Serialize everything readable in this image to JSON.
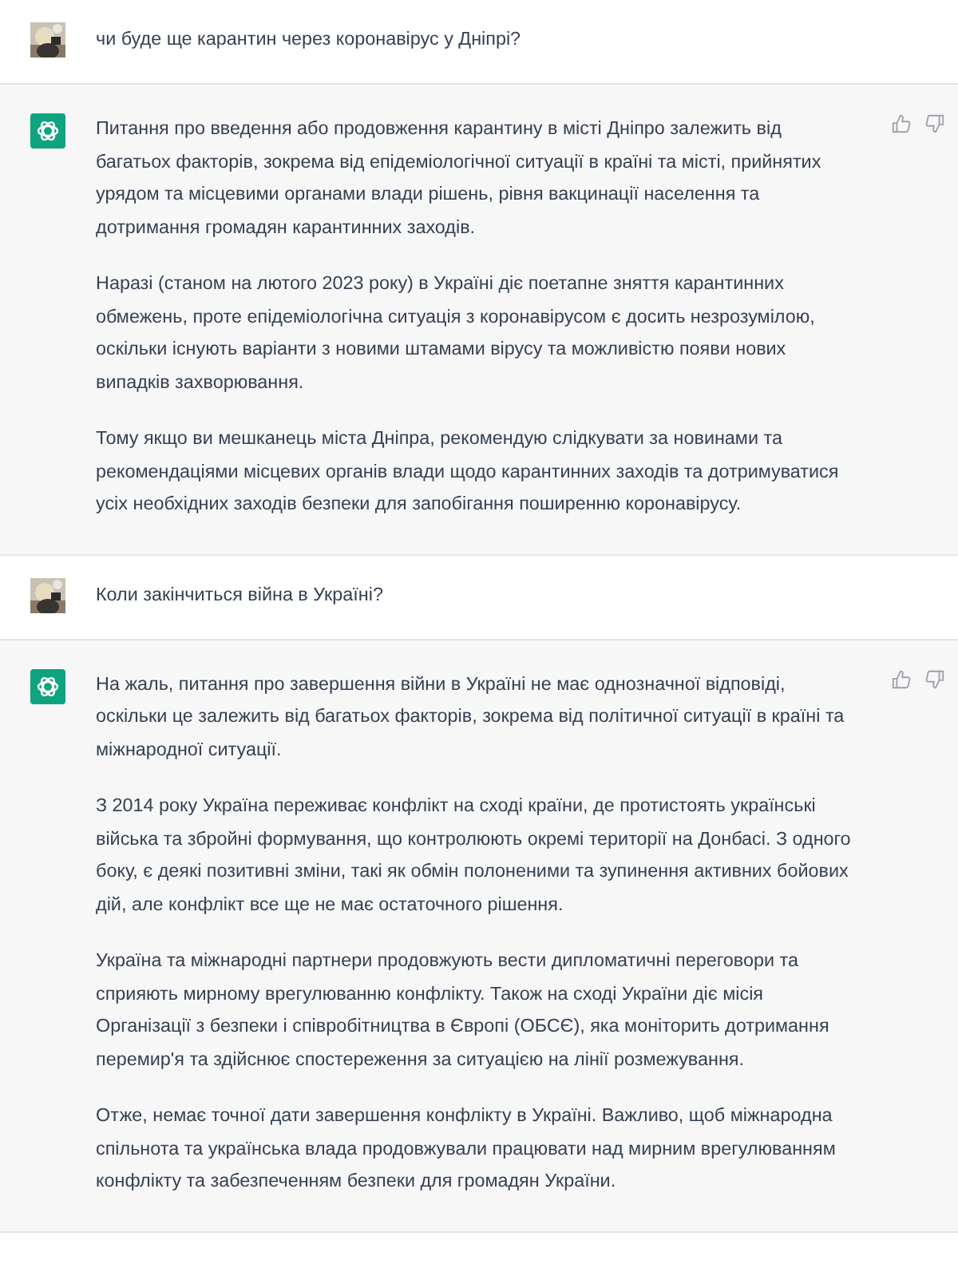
{
  "messages": [
    {
      "kind": "user",
      "paragraphs": [
        "чи буде ще карантин через коронавірус у Дніпрі?"
      ]
    },
    {
      "kind": "assistant",
      "paragraphs": [
        "Питання про введення або продовження карантину в місті Дніпро залежить від багатьох факторів, зокрема від епідеміологічної ситуації в країні та місті, прийнятих урядом та місцевими органами влади рішень, рівня вакцинації населення та дотримання громадян карантинних заходів.",
        "Наразі (станом на лютого 2023 року) в Україні діє поетапне зняття карантинних обмежень, проте епідеміологічна ситуація з коронавірусом є досить незрозумілою, оскільки існують варіанти з новими штамами вірусу та можливістю появи нових випадків захворювання.",
        "Тому якщо ви мешканець міста Дніпра, рекомендую слідкувати за новинами та рекомендаціями місцевих органів влади щодо карантинних заходів та дотримуватися усіх необхідних заходів безпеки для запобігання поширенню коронавірусу."
      ]
    },
    {
      "kind": "user",
      "paragraphs": [
        "Коли закінчиться війна в Україні?"
      ]
    },
    {
      "kind": "assistant",
      "paragraphs": [
        "На жаль, питання про завершення війни в Україні не має однозначної відповіді, оскільки це залежить від багатьох факторів, зокрема від політичної ситуації в країні та міжнародної ситуації.",
        "З 2014 року Україна переживає конфлікт на сході країни, де протистоять українські війська та збройні формування, що контролюють окремі території на Донбасі. З одного боку, є деякі позитивні зміни, такі як обмін полоненими та зупинення активних бойових дій, але конфлікт все ще не має остаточного рішення.",
        "Україна та міжнародні партнери продовжують вести дипломатичні переговори та сприяють мирному врегулюванню конфлікту. Також на сході України діє місія Організації з безпеки і співробітництва в Європі (ОБСЄ), яка моніторить дотримання перемир'я та здійснює спостереження за ситуацією на лінії розмежування.",
        "Отже, немає точної дати завершення конфлікту в Україні. Важливо, щоб міжнародна спільнота та українська влада продовжували працювати над мирним врегулюванням конфлікту та забезпеченням безпеки для громадян України."
      ]
    }
  ]
}
